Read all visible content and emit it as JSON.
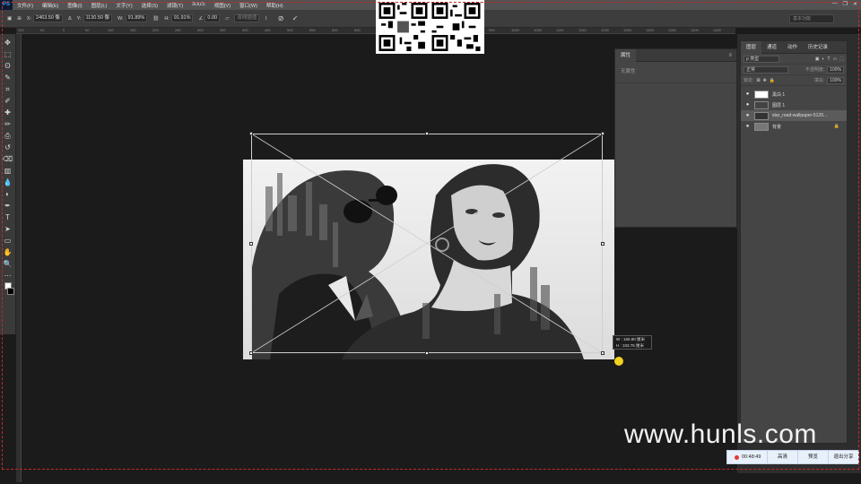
{
  "app": {
    "logo": "PS"
  },
  "menubar": {
    "items": [
      "文件(F)",
      "编辑(E)",
      "图像(I)",
      "图层(L)",
      "文字(Y)",
      "选择(S)",
      "滤镜(T)",
      "3D(D)",
      "视图(V)",
      "窗口(W)",
      "帮助(H)"
    ],
    "controls": [
      "—",
      "❐",
      "✕"
    ]
  },
  "options": {
    "x_label": "X:",
    "x_value": "2463.50 像",
    "y_label": "Y:",
    "y_value": "1130.50 像",
    "w_label": "W:",
    "w_value": "91.89%",
    "h_label": "H:",
    "h_value": "91.91%",
    "angle_value": "0.00",
    "interp_label": "双线插值",
    "workspace": "基本功能"
  },
  "ruler": {
    "marks": [
      "100",
      "50",
      "0",
      "50",
      "100",
      "150",
      "200",
      "250",
      "300",
      "350",
      "400",
      "450",
      "500",
      "550",
      "600",
      "650",
      "700",
      "750",
      "800",
      "850",
      "900",
      "950",
      "1000",
      "1050",
      "1100",
      "1150",
      "1200",
      "1250",
      "1300",
      "1350",
      "1400",
      "1450"
    ]
  },
  "toolbar": {
    "tools": [
      "move-tool",
      "marquee-tool",
      "lasso-tool",
      "quick-select-tool",
      "crop-tool",
      "eyedropper-tool",
      "healing-brush-tool",
      "brush-tool",
      "clone-stamp-tool",
      "history-brush-tool",
      "eraser-tool",
      "gradient-tool",
      "blur-tool",
      "dodge-tool",
      "pen-tool",
      "type-tool",
      "path-select-tool",
      "rectangle-tool",
      "hand-tool",
      "zoom-tool",
      "more-tools"
    ],
    "glyphs": [
      "✥",
      "⬚",
      "ʘ",
      "✎",
      "⌗",
      "✐",
      "✚",
      "✏",
      "⎙",
      "↺",
      "⌫",
      "▥",
      "💧",
      "◐",
      "✒",
      "T",
      "➤",
      "▭",
      "✋",
      "🔍",
      "⋯"
    ]
  },
  "transform": {
    "w_line": "W : 165.90 厘米",
    "h_line": "H : 103.75 厘米"
  },
  "properties_panel": {
    "tab": "属性",
    "body_text": "无属性"
  },
  "layers_panel": {
    "tabs": [
      "图层",
      "通道",
      "动作",
      "历史记录"
    ],
    "filter_label": "ρ 类型",
    "blend_mode": "正常",
    "opacity_label": "不透明度:",
    "opacity_value": "100%",
    "lock_label": "锁定:",
    "fill_label": "填充:",
    "fill_value": "100%",
    "layers": [
      {
        "name": "黑白 1",
        "selected": false
      },
      {
        "name": "图层 1",
        "selected": false
      },
      {
        "name": "star_road-wallpaper-5120...",
        "selected": true
      },
      {
        "name": "背景",
        "selected": false
      }
    ]
  },
  "recording": {
    "time": "00:48:49",
    "buttons": [
      "高清",
      "预览",
      "退出分享"
    ]
  },
  "watermark": "www.hunls.com",
  "colors": {
    "accent": "#31a8ff",
    "record_red": "#e53935",
    "frame_red": "#c62828"
  }
}
